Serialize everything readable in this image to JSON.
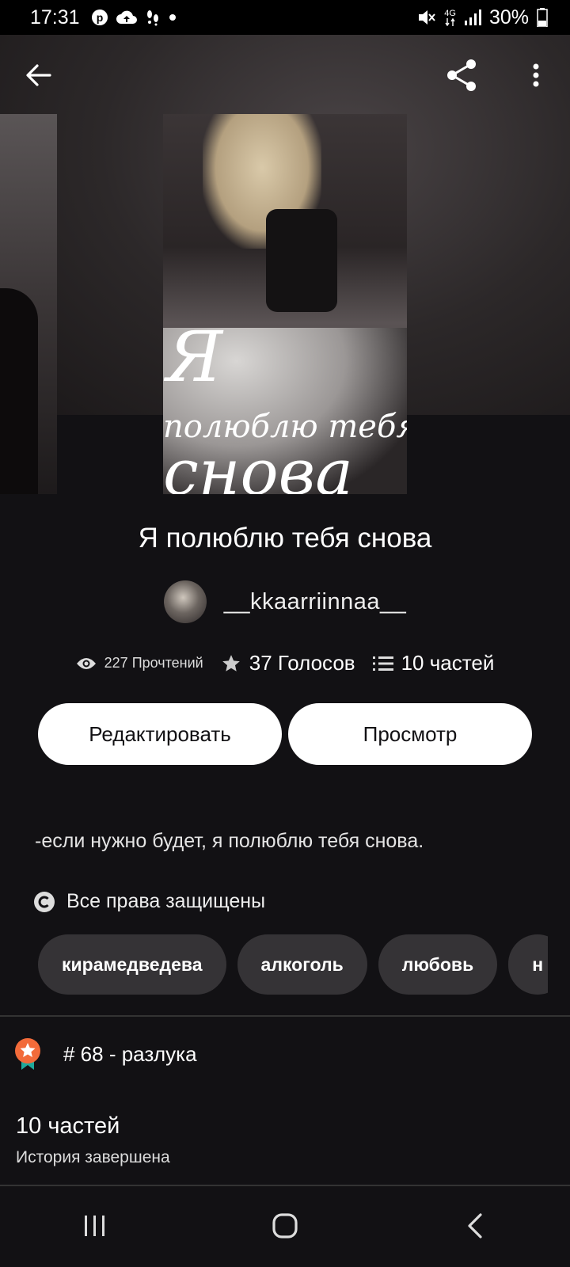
{
  "status_bar": {
    "time": "17:31",
    "network": "4G",
    "battery": "30%"
  },
  "book": {
    "cover_text": [
      "Я",
      "полюблю тебя",
      "снова"
    ],
    "title": "Я полюблю тебя снова",
    "author": "__kkaarriinnaa__",
    "reads": "227 Прочтений",
    "votes": "37 Голосов",
    "parts": "10 частей",
    "description": "-если нужно будет, я полюблю тебя снова.",
    "rights": "Все права защищены",
    "tags": [
      "кирамедведева",
      "алкоголь",
      "любовь",
      "н"
    ],
    "rank": "# 68 - разлука",
    "parts_count": "10 частей",
    "completion": "История завершена"
  },
  "actions": {
    "edit_label": "Редактировать",
    "view_label": "Просмотр"
  },
  "colors": {
    "background": "#121114",
    "button_bg": "#ffffff",
    "tag_bg": "#353336",
    "rank_badge": "#f26b3a",
    "rank_ribbon": "#1fa99b"
  }
}
